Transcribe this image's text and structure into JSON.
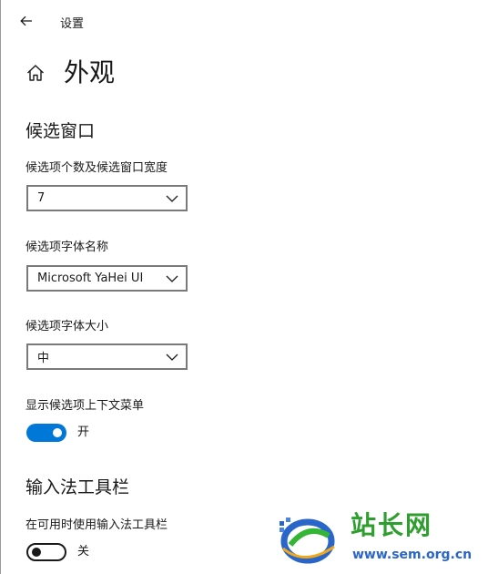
{
  "header": {
    "back_icon": "back-arrow-icon",
    "title": "设置"
  },
  "page": {
    "home_icon": "home-icon",
    "title": "外观"
  },
  "candidate_window": {
    "section_title": "候选窗口",
    "count": {
      "label": "候选项个数及候选窗口宽度",
      "value": "7"
    },
    "font_name": {
      "label": "候选项字体名称",
      "value": "Microsoft YaHei UI"
    },
    "font_size": {
      "label": "候选项字体大小",
      "value": "中"
    },
    "context_menu": {
      "label": "显示候选项上下文菜单",
      "state": "开",
      "on": true
    }
  },
  "ime_toolbar": {
    "section_title": "输入法工具栏",
    "use_toolbar": {
      "label": "在可用时使用输入法工具栏",
      "state": "关",
      "on": false
    }
  },
  "watermark": {
    "title": "站长网",
    "url": "www.sem.org.cn"
  },
  "colors": {
    "accent": "#0078d7",
    "border": "#7a7a7a",
    "watermark_green": "#2e9e2e",
    "watermark_blue": "#2a66c9"
  }
}
